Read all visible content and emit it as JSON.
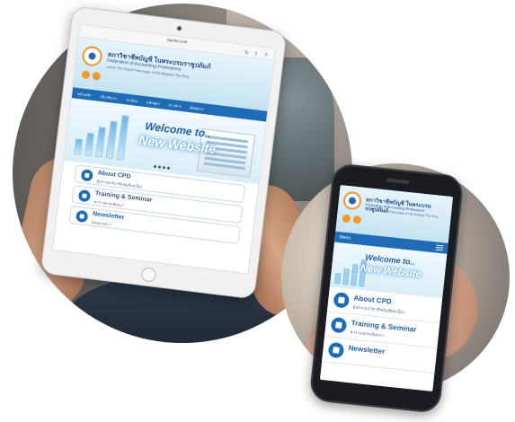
{
  "tablet": {
    "url": "fap.tfac.or.th",
    "org_thai": "สภาวิชาชีพบัญชี ในพระบรมราชูปถัมภ์",
    "org_english": "Federation of Accounting Professions",
    "org_sub": "Under The Royal Patronage of His Majesty The King",
    "nav": [
      "หน้าหลัก",
      "เกี่ยวกับเรา",
      "ระเบียบ",
      "หลักสูตร",
      "ข่าวสาร",
      "ติดต่อเรา"
    ],
    "banner_welcome": "Welcome to..",
    "banner_new": "New Website",
    "cards": [
      {
        "title": "About CPD",
        "subtitle": "ผู้ประกอบวิชาชีพบัญชีต่อเนื่อง"
      },
      {
        "title": "Training & Seminar",
        "subtitle": "ตารางอบรมสัมมนา"
      },
      {
        "title": "Newsletter",
        "subtitle": "จดหมายข่าว"
      }
    ]
  },
  "phone": {
    "org_thai": "สภาวิชาชีพบัญชี ในพระบรมราชูปถัมภ์",
    "org_english": "Federation of Accounting Professions",
    "org_sub": "Under The Royal Patronage of His Majesty The King",
    "nav_label": "Menu",
    "banner_welcome": "Welcome to..",
    "banner_new": "New Website",
    "cards": [
      {
        "title": "About CPD",
        "subtitle": "ผู้ประกอบวิชาชีพบัญชีต่อเนื่อง"
      },
      {
        "title": "Training & Seminar",
        "subtitle": "ตารางอบรมสัมมนา"
      },
      {
        "title": "Newsletter",
        "subtitle": ""
      }
    ]
  },
  "colors": {
    "brand_blue": "#1e6cb6",
    "accent_orange": "#f29a2a",
    "sky": "#c5e3f3"
  }
}
